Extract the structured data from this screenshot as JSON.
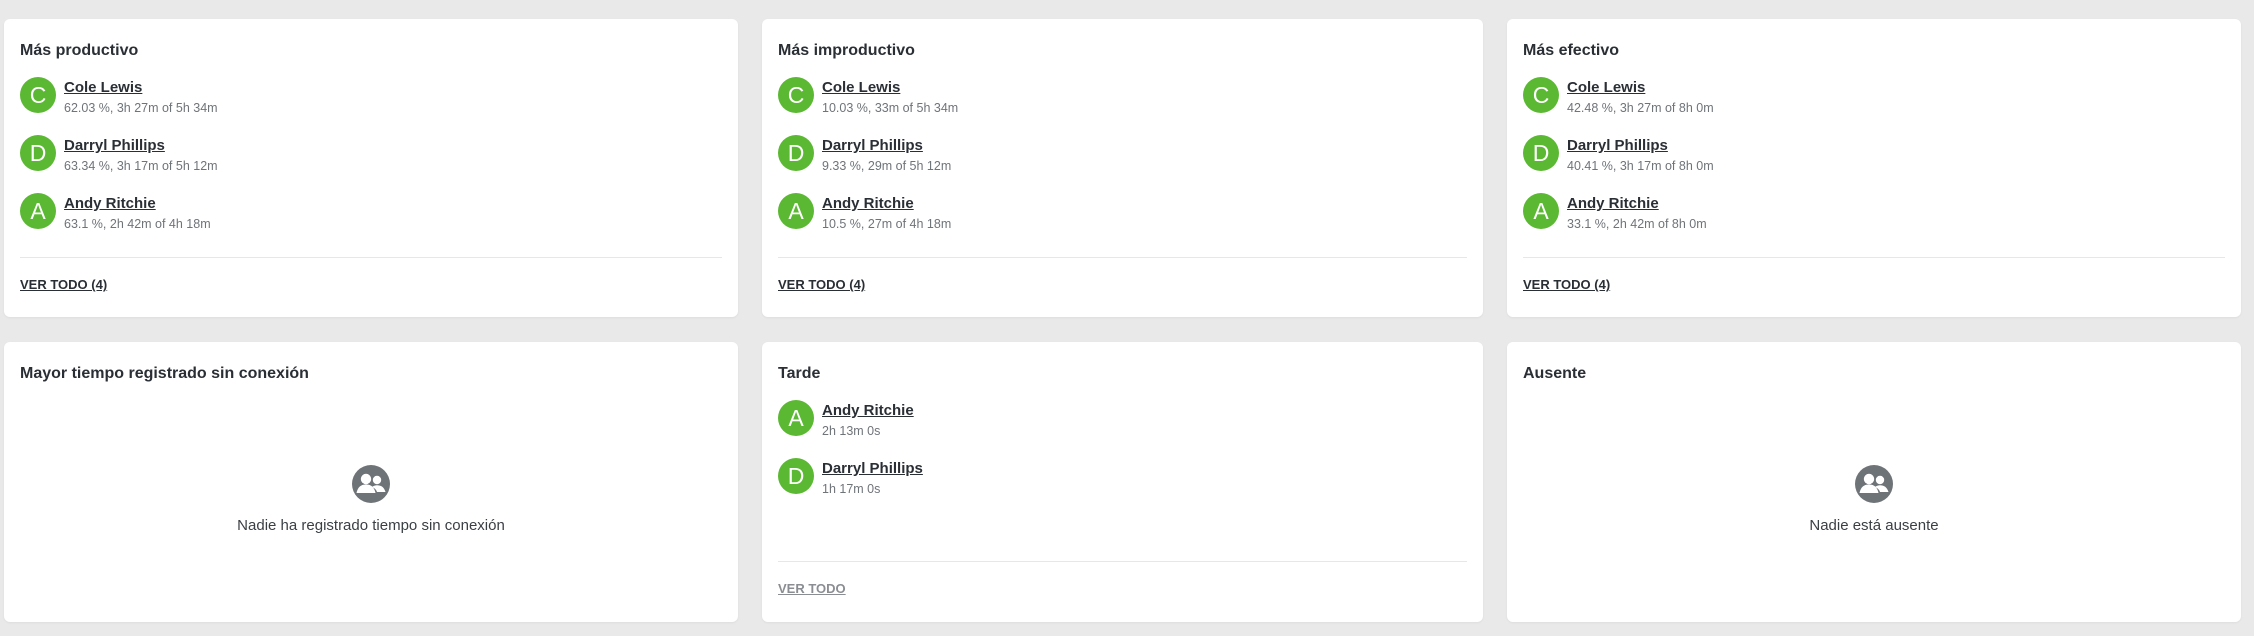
{
  "colors": {
    "avatar_bg": "#5bb832",
    "page_bg": "#e8e9e8",
    "card_bg": "#ffffff"
  },
  "cards": [
    {
      "title": "Más productivo",
      "users": [
        {
          "initial": "C",
          "name": "Cole Lewis",
          "stat": "62.03 %, 3h 27m of 5h 34m"
        },
        {
          "initial": "D",
          "name": "Darryl Phillips",
          "stat": "63.34 %, 3h 17m of 5h 12m"
        },
        {
          "initial": "A",
          "name": "Andy Ritchie",
          "stat": "63.1 %, 2h 42m of 4h 18m"
        }
      ],
      "see_all": "VER TODO (4)"
    },
    {
      "title": "Más improductivo",
      "users": [
        {
          "initial": "C",
          "name": "Cole Lewis",
          "stat": "10.03 %, 33m of 5h 34m"
        },
        {
          "initial": "D",
          "name": "Darryl Phillips",
          "stat": "9.33 %, 29m of 5h 12m"
        },
        {
          "initial": "A",
          "name": "Andy Ritchie",
          "stat": "10.5 %, 27m of 4h 18m"
        }
      ],
      "see_all": "VER TODO (4)"
    },
    {
      "title": "Más efectivo",
      "users": [
        {
          "initial": "C",
          "name": "Cole Lewis",
          "stat": "42.48 %, 3h 27m of 8h 0m"
        },
        {
          "initial": "D",
          "name": "Darryl Phillips",
          "stat": "40.41 %, 3h 17m of 8h 0m"
        },
        {
          "initial": "A",
          "name": "Andy Ritchie",
          "stat": "33.1 %, 2h 42m of 8h 0m"
        }
      ],
      "see_all": "VER TODO (4)"
    },
    {
      "title": "Mayor tiempo registrado sin conexión",
      "empty_icon": "people-icon",
      "empty_text": "Nadie ha registrado tiempo sin conexión"
    },
    {
      "title": "Tarde",
      "users": [
        {
          "initial": "A",
          "name": "Andy Ritchie",
          "stat": "2h 13m 0s"
        },
        {
          "initial": "D",
          "name": "Darryl Phillips",
          "stat": "1h 17m 0s"
        }
      ],
      "see_all": "VER TODO"
    },
    {
      "title": "Ausente",
      "empty_icon": "people-icon",
      "empty_text": "Nadie está ausente"
    }
  ]
}
